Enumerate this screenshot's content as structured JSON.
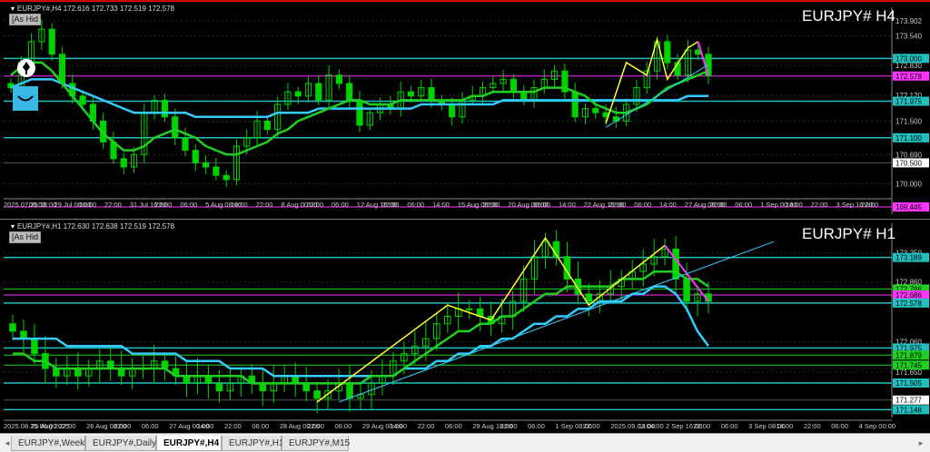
{
  "colors": {
    "background": "#000000",
    "candle": "#00d200",
    "ma_fast": "#20d020",
    "ma_slow": "#33ccff",
    "zigzag": "#ffff33",
    "zigzag_last": "#ff33ff",
    "hline": "#20c0c0",
    "price_label": "#ff33ff"
  },
  "h4": {
    "title": "EURJPY#,H4  172.616 172.733 172.519 172.578",
    "symbol_label": "EURJPY# H4",
    "as_hide_label": "[As Hid",
    "cursor_time_label": "2025.07.25 18:00",
    "price_axis": {
      "labels": [
        "173.902",
        "173.540",
        "172.830",
        "172.120",
        "171.500",
        "170.690",
        "170.000"
      ],
      "highlighted": [
        {
          "text": "173.000",
          "color": "#20c0c0",
          "value": 173.0
        },
        {
          "text": "172.578",
          "color": "#ff33ff",
          "value": 172.578
        },
        {
          "text": "171.975",
          "color": "#20c0c0",
          "value": 171.975
        },
        {
          "text": "171.100",
          "color": "#20c0c0",
          "value": 171.1
        },
        {
          "text": "170.500",
          "color": "#ffffff",
          "value": 170.5
        },
        {
          "text": "169.445",
          "color": "#ff33ff",
          "value": 169.445
        }
      ]
    },
    "time_axis": [
      "2025.07.25 18:00",
      "06:00",
      "29 Jul 00:00",
      "06:00",
      "22:00",
      "31 Jul 16:00",
      "22:00",
      "06:00",
      "5 Aug 08:00",
      "14:00",
      "22:00",
      "8 Aug 00:00",
      "22:00",
      "06:00",
      "12 Aug 16:00",
      "22:00",
      "06:00",
      "14:00",
      "15 Aug 08:00",
      "22:00",
      "20 Aug 00:00",
      "06:00",
      "14:00",
      "22 Aug 16:00",
      "22:00",
      "06:00",
      "14:00",
      "27 Aug 08:00",
      "22:00",
      "06:00",
      "1 Sep 00:00",
      "14:00",
      "22:00",
      "3 Sep 16:00",
      "22:00"
    ]
  },
  "h1": {
    "title": "EURJPY#,H1  172.630 172.638 172.519 172.578",
    "symbol_label": "EURJPY# H1",
    "as_hide_label": "[As Hid",
    "cursor_time_labels": [
      "2025.09.02 10:00",
      "2025.09.02 04:00"
    ],
    "price_axis": {
      "labels": [
        "173.250",
        "172.860",
        "172.060",
        "171.650"
      ],
      "highlighted": [
        {
          "text": "173.189",
          "color": "#20c0c0",
          "value": 173.189
        },
        {
          "text": "172.766",
          "color": "#20d020",
          "value": 172.766
        },
        {
          "text": "172.686",
          "color": "#ff33ff",
          "value": 172.686
        },
        {
          "text": "172.578",
          "color": "#20c0c0",
          "value": 172.578
        },
        {
          "text": "171.975",
          "color": "#20c0c0",
          "value": 171.975
        },
        {
          "text": "171.879",
          "color": "#20d020",
          "value": 171.879
        },
        {
          "text": "171.745",
          "color": "#20d020",
          "value": 171.745
        },
        {
          "text": "171.505",
          "color": "#20c0c0",
          "value": 171.505
        },
        {
          "text": "171.277",
          "color": "#ffffff",
          "value": 171.277
        },
        {
          "text": "171.148",
          "color": "#20c0c0",
          "value": 171.148
        }
      ]
    },
    "time_axis": [
      "2025.08.25 06:00",
      "25 Aug 2025",
      "22:00",
      "26 Aug 08:00",
      "22:00",
      "06:00",
      "27 Aug 00:00",
      "14:00",
      "22:00",
      "06:00",
      "28 Aug 00:00",
      "22:00",
      "06:00",
      "29 Aug 00:00",
      "14:00",
      "22:00",
      "06:00",
      "29 Aug 16:00",
      "22:00",
      "06:00",
      "1 Sep 08:00",
      "22:00",
      "2025.09.02 04:00",
      "14:00",
      "2 Sep 16:00",
      "22:00",
      "06:00",
      "3 Sep 08:00",
      "14:00",
      "22:00",
      "06:00",
      "4 Sep 00:00"
    ]
  },
  "chart_data": [
    {
      "type": "candlestick",
      "title": "EURJPY#,H4",
      "ylim": [
        169.445,
        174.05
      ],
      "series": [
        {
          "name": "close",
          "values": [
            172.3,
            172.9,
            173.4,
            173.7,
            173.1,
            172.4,
            172.1,
            171.9,
            171.5,
            171.0,
            170.6,
            170.4,
            170.7,
            171.7,
            172.0,
            171.6,
            171.1,
            170.8,
            170.5,
            170.4,
            170.2,
            170.1,
            170.9,
            171.1,
            171.5,
            171.3,
            171.9,
            172.2,
            172.1,
            172.4,
            172.0,
            172.6,
            172.4,
            172.0,
            171.4,
            171.7,
            171.9,
            171.8,
            172.2,
            172.1,
            172.3,
            172.0,
            171.9,
            171.6,
            172.0,
            172.1,
            172.3,
            172.4,
            172.5,
            172.2,
            172.0,
            172.3,
            172.5,
            172.7,
            172.2,
            171.6,
            171.8,
            171.7,
            171.6,
            171.5,
            171.9,
            172.3,
            172.7,
            173.4,
            172.9,
            172.6,
            173.2,
            173.1,
            172.58
          ]
        },
        {
          "name": "ma_fast",
          "values": [
            172.6,
            172.8,
            172.9,
            172.9,
            172.7,
            172.4,
            172.1,
            171.8,
            171.5,
            171.2,
            171.0,
            170.8,
            170.8,
            170.9,
            171.1,
            171.2,
            171.3,
            171.2,
            171.1,
            170.9,
            170.8,
            170.7,
            170.7,
            170.8,
            170.9,
            171.0,
            171.2,
            171.3,
            171.5,
            171.6,
            171.7,
            171.8,
            171.9,
            172.0,
            172.0,
            171.9,
            171.9,
            171.9,
            172.0,
            172.0,
            172.0,
            172.0,
            172.0,
            172.0,
            172.0,
            172.1,
            172.1,
            172.2,
            172.2,
            172.2,
            172.2,
            172.2,
            172.3,
            172.3,
            172.3,
            172.2,
            172.1,
            171.9,
            171.8,
            171.7,
            171.7,
            171.8,
            171.9,
            172.1,
            172.3,
            172.4,
            172.5,
            172.6,
            172.7
          ]
        },
        {
          "name": "ma_slow",
          "values": [
            172.3,
            172.4,
            172.5,
            172.5,
            172.5,
            172.4,
            172.3,
            172.2,
            172.1,
            172.0,
            171.9,
            171.8,
            171.7,
            171.7,
            171.7,
            171.7,
            171.7,
            171.7,
            171.6,
            171.6,
            171.6,
            171.6,
            171.6,
            171.6,
            171.6,
            171.6,
            171.7,
            171.7,
            171.7,
            171.7,
            171.8,
            171.8,
            171.8,
            171.8,
            171.8,
            171.8,
            171.8,
            171.8,
            171.8,
            171.8,
            171.9,
            171.9,
            171.9,
            171.9,
            171.9,
            171.9,
            171.9,
            171.9,
            172.0,
            172.0,
            172.0,
            172.0,
            172.0,
            172.0,
            172.0,
            172.0,
            172.0,
            172.0,
            172.0,
            172.0,
            172.0,
            172.0,
            172.0,
            172.0,
            172.0,
            172.0,
            172.1,
            172.1,
            172.1
          ]
        }
      ]
    },
    {
      "type": "candlestick",
      "title": "EURJPY#,H1",
      "ylim": [
        171.14,
        173.55
      ],
      "series": [
        {
          "name": "close",
          "values": [
            172.2,
            172.1,
            171.9,
            171.7,
            171.6,
            171.7,
            171.6,
            171.7,
            171.8,
            171.7,
            171.6,
            171.7,
            171.7,
            171.8,
            171.7,
            171.6,
            171.5,
            171.6,
            171.5,
            171.4,
            171.5,
            171.6,
            171.5,
            171.4,
            171.5,
            171.6,
            171.5,
            171.4,
            171.3,
            171.4,
            171.5,
            171.3,
            171.35,
            171.5,
            171.6,
            171.8,
            171.9,
            172.0,
            172.1,
            172.3,
            172.4,
            172.5,
            172.5,
            172.4,
            172.3,
            172.4,
            172.6,
            172.9,
            173.2,
            173.4,
            173.2,
            172.9,
            172.7,
            172.6,
            172.7,
            172.8,
            172.9,
            173.0,
            173.1,
            173.2,
            173.3,
            172.9,
            172.6,
            172.7,
            172.6
          ]
        },
        {
          "name": "ma_fast",
          "values": [
            171.9,
            171.9,
            171.8,
            171.8,
            171.7,
            171.7,
            171.7,
            171.7,
            171.7,
            171.7,
            171.7,
            171.7,
            171.7,
            171.7,
            171.7,
            171.6,
            171.6,
            171.6,
            171.6,
            171.6,
            171.6,
            171.6,
            171.5,
            171.5,
            171.5,
            171.5,
            171.5,
            171.5,
            171.5,
            171.5,
            171.5,
            171.5,
            171.5,
            171.6,
            171.6,
            171.6,
            171.7,
            171.8,
            171.9,
            172.0,
            172.1,
            172.2,
            172.2,
            172.3,
            172.3,
            172.4,
            172.4,
            172.5,
            172.6,
            172.7,
            172.7,
            172.8,
            172.8,
            172.8,
            172.8,
            172.8,
            172.9,
            172.9,
            172.9,
            173.0,
            173.0,
            173.0,
            172.9,
            172.9,
            172.8
          ]
        },
        {
          "name": "ma_slow",
          "values": [
            172.1,
            172.1,
            172.1,
            172.1,
            172.1,
            172.0,
            172.0,
            172.0,
            172.0,
            172.0,
            172.0,
            171.9,
            171.9,
            171.9,
            171.9,
            171.9,
            171.8,
            171.8,
            171.8,
            171.8,
            171.7,
            171.7,
            171.7,
            171.7,
            171.6,
            171.6,
            171.6,
            171.6,
            171.6,
            171.6,
            171.6,
            171.6,
            171.6,
            171.6,
            171.6,
            171.6,
            171.7,
            171.7,
            171.7,
            171.8,
            171.8,
            171.9,
            171.9,
            172.0,
            172.0,
            172.1,
            172.1,
            172.2,
            172.3,
            172.3,
            172.4,
            172.4,
            172.5,
            172.5,
            172.6,
            172.6,
            172.6,
            172.7,
            172.7,
            172.8,
            172.8,
            172.7,
            172.5,
            172.2,
            172.0
          ]
        }
      ]
    }
  ],
  "tabs": [
    "EURJPY#,Weekly",
    "EURJPY#,Daily",
    "EURJPY#,H4",
    "EURJPY#,H1",
    "EURJPY#,M15"
  ],
  "active_tab": "EURJPY#,H4"
}
